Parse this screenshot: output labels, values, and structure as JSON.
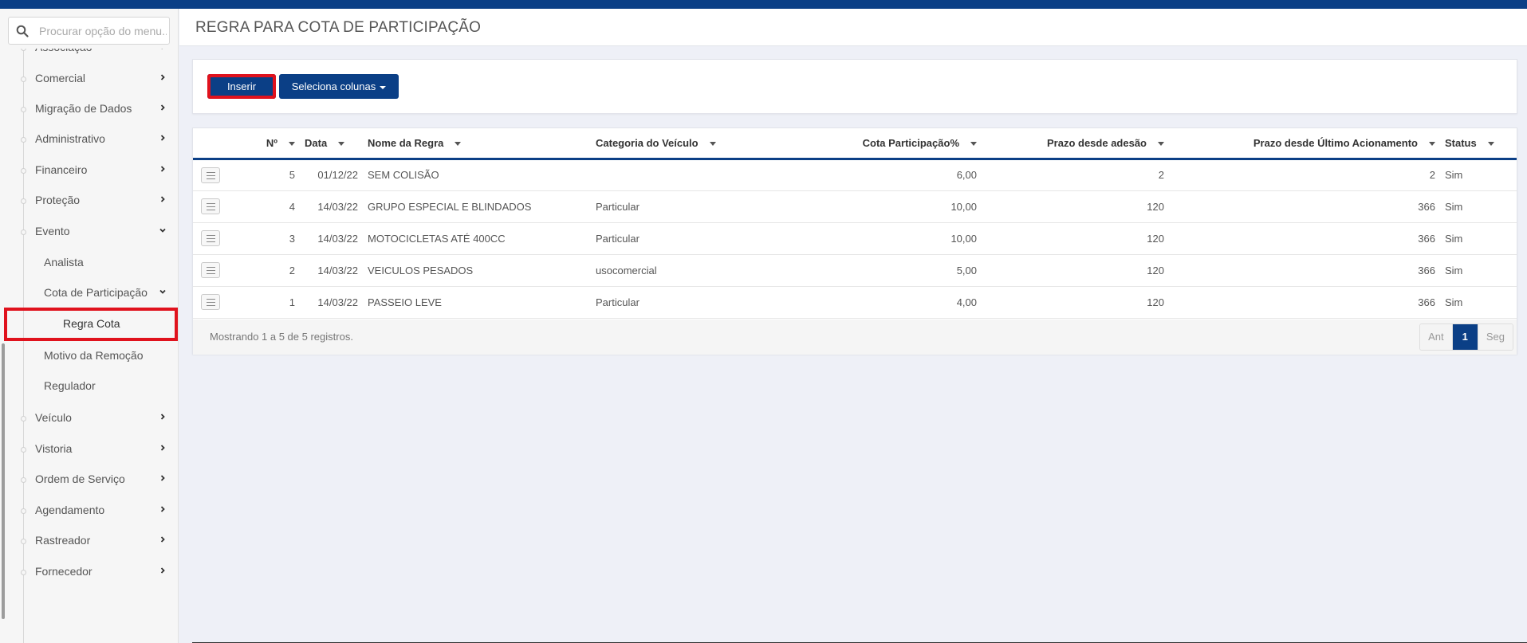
{
  "colors": {
    "brand": "#0b3f86",
    "highlight": "#e0121d"
  },
  "search": {
    "placeholder": "Procurar opção do menu..."
  },
  "sidebar": {
    "items": [
      {
        "label": "Associação",
        "type": "parent",
        "icon": "chevron-right-icon"
      },
      {
        "label": "Comercial",
        "type": "parent",
        "icon": "chevron-right-icon"
      },
      {
        "label": "Migração de Dados",
        "type": "parent",
        "icon": "chevron-right-icon"
      },
      {
        "label": "Administrativo",
        "type": "parent",
        "icon": "chevron-right-icon"
      },
      {
        "label": "Financeiro",
        "type": "parent",
        "icon": "chevron-right-icon"
      },
      {
        "label": "Proteção",
        "type": "parent",
        "icon": "chevron-right-icon"
      },
      {
        "label": "Evento",
        "type": "parent-open",
        "icon": "chevron-down-icon"
      },
      {
        "label": "Analista",
        "type": "child"
      },
      {
        "label": "Cota de Participação",
        "type": "child-open",
        "icon": "chevron-down-icon"
      },
      {
        "label": "Regra Cota",
        "type": "grandchild-active"
      },
      {
        "label": "Motivo da Remoção",
        "type": "child"
      },
      {
        "label": "Regulador",
        "type": "child"
      },
      {
        "label": "Veículo",
        "type": "parent",
        "icon": "chevron-right-icon"
      },
      {
        "label": "Vistoria",
        "type": "parent",
        "icon": "chevron-right-icon"
      },
      {
        "label": "Ordem de Serviço",
        "type": "parent",
        "icon": "chevron-right-icon"
      },
      {
        "label": "Agendamento",
        "type": "parent",
        "icon": "chevron-right-icon"
      },
      {
        "label": "Rastreador",
        "type": "parent",
        "icon": "chevron-right-icon"
      },
      {
        "label": "Fornecedor",
        "type": "parent",
        "icon": "chevron-right-icon"
      }
    ]
  },
  "header": {
    "title": "REGRA PARA COTA DE PARTICIPAÇÃO"
  },
  "toolbar": {
    "insert_label": "Inserir",
    "columns_label": "Seleciona colunas"
  },
  "table": {
    "columns": [
      "Nº",
      "Data",
      "Nome da Regra",
      "Categoria do Veículo",
      "Cota Participação%",
      "Prazo desde adesão",
      "Prazo desde Último Acionamento",
      "Status"
    ],
    "rows": [
      [
        "5",
        "01/12/22",
        "SEM COLISÃO",
        "",
        "6,00",
        "2",
        "2",
        "Sim"
      ],
      [
        "4",
        "14/03/22",
        "GRUPO ESPECIAL E BLINDADOS",
        "Particular",
        "10,00",
        "120",
        "366",
        "Sim"
      ],
      [
        "3",
        "14/03/22",
        "MOTOCICLETAS ATÉ 400CC",
        "Particular",
        "10,00",
        "120",
        "366",
        "Sim"
      ],
      [
        "2",
        "14/03/22",
        "VEICULOS PESADOS",
        "usocomercial",
        "5,00",
        "120",
        "366",
        "Sim"
      ],
      [
        "1",
        "14/03/22",
        "PASSEIO LEVE",
        "Particular",
        "4,00",
        "120",
        "366",
        "Sim"
      ]
    ],
    "footer_info": "Mostrando 1 a 5 de 5 registros.",
    "pager": {
      "prev": "Ant",
      "current": "1",
      "next": "Seg"
    }
  }
}
